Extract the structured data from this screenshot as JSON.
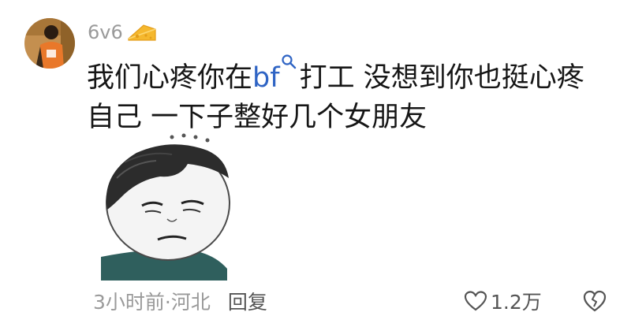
{
  "comment": {
    "username": "6v6",
    "badge_icon": "cheese-icon",
    "text_part1": "我们心疼你在",
    "link_text": "bf",
    "text_part2": "打工 没想到你也挺心疼",
    "text_line2": "自己 一下子整好几个女朋友",
    "sticker": "panda-face-meme-sticker",
    "time_location": "3小时前·河北",
    "reply_label": "回复",
    "like_count": "1.2万"
  },
  "colors": {
    "text": "#161616",
    "muted": "#9a9a9a",
    "link": "#2f64c4",
    "badge": "#f5b82e"
  }
}
